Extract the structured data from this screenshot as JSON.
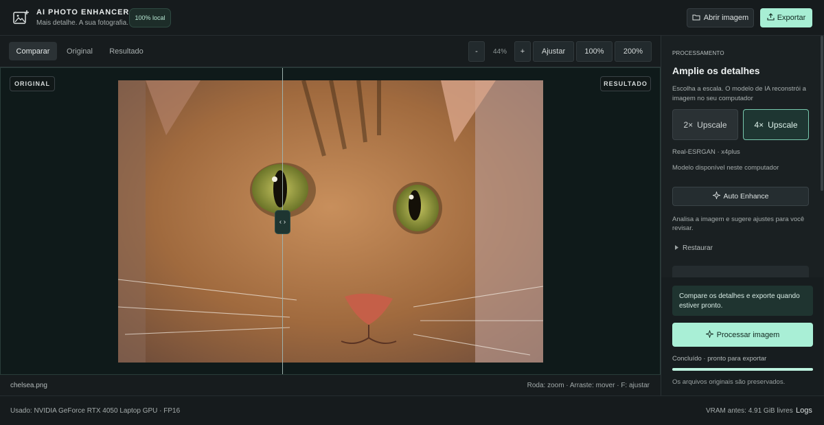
{
  "header": {
    "title": "AI PHOTO ENHANCER",
    "subtitle": "Mais detalhe. A sua fotografia.",
    "badge": "100% local",
    "open_label": "Abrir imagem",
    "export_label": "Exportar"
  },
  "toolbar": {
    "tabs": [
      {
        "label": "Comparar",
        "active": true
      },
      {
        "label": "Original",
        "active": false
      },
      {
        "label": "Resultado",
        "active": false
      }
    ],
    "zoom_out": "-",
    "zoom_value": "44%",
    "zoom_in": "+",
    "fit": "Ajustar",
    "zoom_100": "100%",
    "zoom_200": "200%"
  },
  "canvas": {
    "left_tag": "ORIGINAL",
    "right_tag": "RESULTADO",
    "handle_glyph": "‹ ›",
    "filename": "chelsea.png",
    "hints": "Roda: zoom  ·  Arraste: mover  ·  F: ajustar"
  },
  "panel": {
    "section": "PROCESSAMENTO",
    "title": "Amplie os detalhes",
    "description": "Escolha a escala. O modelo de IA reconstrói a imagem no seu computador",
    "scales": [
      {
        "factor": "2×",
        "label": "Upscale",
        "selected": false
      },
      {
        "factor": "4×",
        "label": "Upscale",
        "selected": true
      }
    ],
    "model": "Real-ESRGAN  ·  x4plus",
    "model_status": "Modelo disponível neste computador",
    "auto_label": "Auto Enhance",
    "auto_desc": "Analisa a imagem e sugere ajustes para você revisar.",
    "restore_label": "Restaurar",
    "notice": "Compare os detalhes e exporte quando estiver pronto.",
    "process_label": "Processar imagem",
    "status": "Concluído · pronto para exportar",
    "progress": 1.0,
    "preserved": "Os arquivos originais são preservados."
  },
  "statusbar": {
    "gpu": "Usado: NVIDIA GeForce RTX 4050 Laptop GPU  ·  FP16",
    "vram": "VRAM antes: 4.91 GiB livres",
    "logs": "Logs"
  },
  "colors": {
    "accent": "#a9efd6",
    "background": "#151a1c",
    "panel": "#1a2022"
  }
}
